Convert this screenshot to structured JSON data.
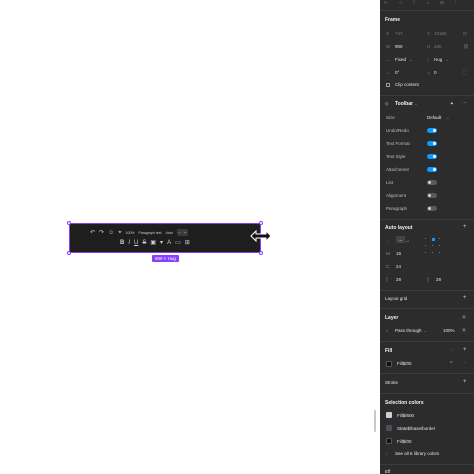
{
  "canvas": {
    "size_badge": "900 × Hug",
    "toolbar": {
      "zoom": "100%",
      "paragraph": "Paragraph text",
      "font": "Arial"
    }
  },
  "panel": {
    "frame": {
      "title": "Frame",
      "x_label": "X",
      "x_value": "747",
      "y_label": "Y",
      "y_value": "43165",
      "w_label": "W",
      "w_value": "900",
      "h_label": "H",
      "h_value": "180",
      "width_mode": "Fixed",
      "height_mode": "Hug",
      "rotation": "0°",
      "radius": "0",
      "clip_content": "Clip content"
    },
    "component": {
      "name": "Toolbar",
      "props": [
        {
          "label": "Size",
          "value": "Default"
        },
        {
          "label": "Undo/Redo",
          "on": true
        },
        {
          "label": "Text Format",
          "on": true
        },
        {
          "label": "Text Style",
          "on": true
        },
        {
          "label": "Attachment",
          "on": true
        },
        {
          "label": "List",
          "on": false
        },
        {
          "label": "Alignment",
          "on": false
        },
        {
          "label": "Paragraph",
          "on": false
        }
      ]
    },
    "auto_layout": {
      "title": "Auto layout",
      "gap": "16",
      "padding_v": "24",
      "padding_left": "28",
      "padding_right": "28"
    },
    "layout_grid": "Layout grid",
    "layer": {
      "title": "Layer",
      "mode": "Pass through",
      "opacity": "100%"
    },
    "fill": {
      "title": "Fill",
      "value": "Fill$/00"
    },
    "stroke": "Stroke",
    "selection_colors": {
      "title": "Selection colors",
      "items": [
        {
          "name": "Fill$/600",
          "color": "#cfcfcf"
        },
        {
          "name": "State$/base/border",
          "color": "#4a4f5a"
        },
        {
          "name": "Fill$/00",
          "color": "#111111"
        }
      ],
      "see_all": "See all 6 library colors"
    },
    "bottom": "Eff"
  },
  "colors": {
    "accent": "#8a3ffc",
    "toggle_on": "#0d99ff",
    "panel_bg": "#2c2c2c"
  }
}
